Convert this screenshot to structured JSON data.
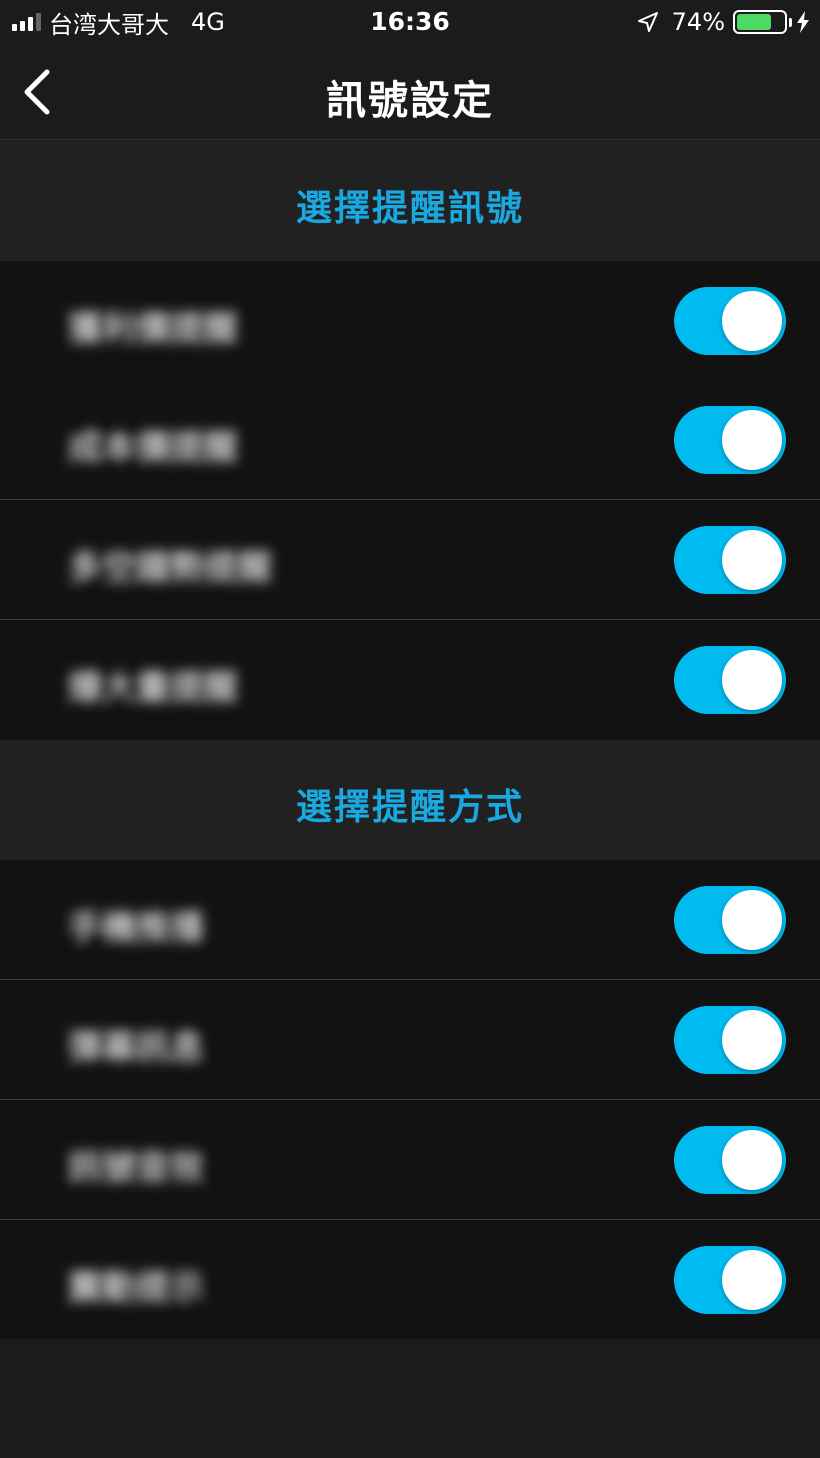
{
  "status_bar": {
    "carrier": "台湾大哥大",
    "network": "4G",
    "time": "16:36",
    "battery_percent": "74%",
    "battery_level": 0.74,
    "signal_bars": 3,
    "icons": [
      "signal-icon",
      "location-arrow-icon",
      "battery-icon",
      "charging-bolt-icon"
    ]
  },
  "nav": {
    "title": "訊號設定",
    "back_icon": "chevron-left-icon"
  },
  "sections": [
    {
      "title": "選擇提醒訊號",
      "items": [
        {
          "label": "獲利價提醒",
          "enabled": true
        },
        {
          "label": "成本價提醒",
          "enabled": true
        },
        {
          "label": "多空趨勢提醒",
          "enabled": true
        },
        {
          "label": "爆大量提醒",
          "enabled": true
        }
      ]
    },
    {
      "title": "選擇提醒方式",
      "items": [
        {
          "label": "手機推播",
          "enabled": true
        },
        {
          "label": "彈幕訊息",
          "enabled": true
        },
        {
          "label": "訊號音效",
          "enabled": true
        },
        {
          "label": "震動提示",
          "enabled": true
        }
      ]
    }
  ],
  "colors": {
    "accent": "#00bbf0",
    "section_title": "#1aa8e0",
    "background": "#1b1b1b",
    "row_background": "#121212",
    "battery_fill": "#4cd964"
  }
}
